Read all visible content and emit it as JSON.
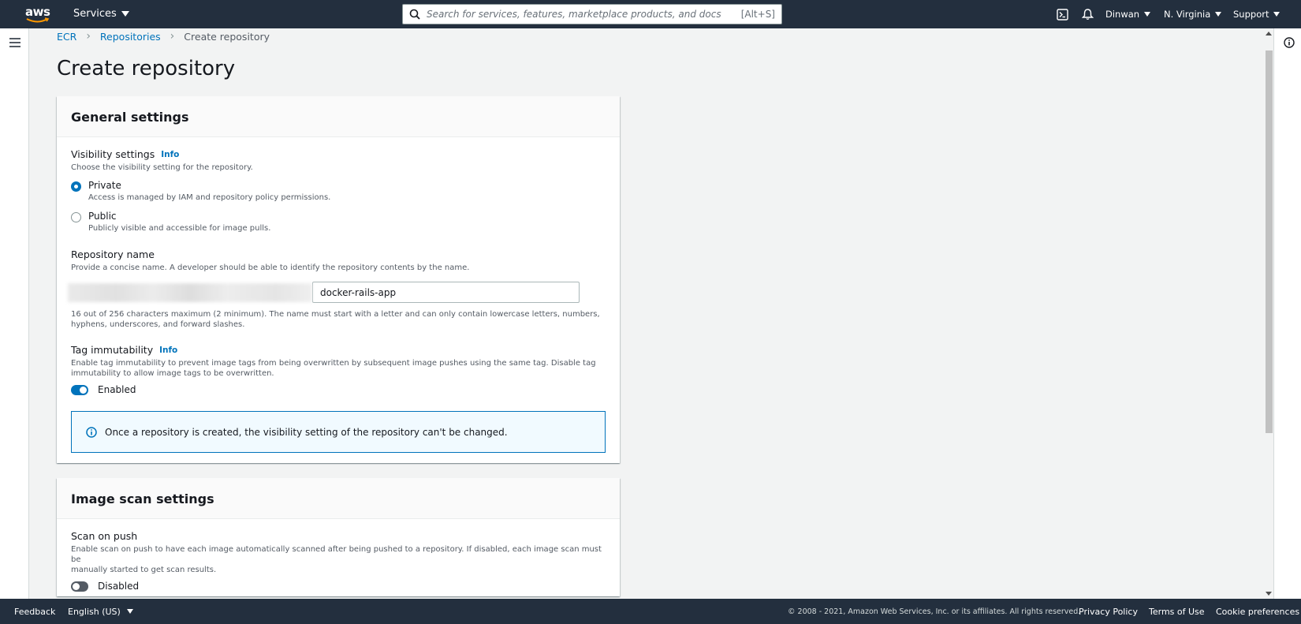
{
  "topnav": {
    "logo": "aws",
    "services_label": "Services",
    "search_placeholder": "Search for services, features, marketplace products, and docs",
    "search_shortcut": "[Alt+S]",
    "account_label": "Dinwan",
    "region_label": "N. Virginia",
    "support_label": "Support"
  },
  "breadcrumb": {
    "items": [
      "ECR",
      "Repositories"
    ],
    "current": "Create repository"
  },
  "page_title": "Create repository",
  "general_settings": {
    "title": "General settings",
    "visibility": {
      "label": "Visibility settings",
      "info": "Info",
      "description": "Choose the visibility setting for the repository.",
      "options": [
        {
          "title": "Private",
          "description": "Access is managed by IAM and repository policy permissions.",
          "checked": true
        },
        {
          "title": "Public",
          "description": "Publicly visible and accessible for image pulls.",
          "checked": false
        }
      ]
    },
    "repository_name": {
      "label": "Repository name",
      "description": "Provide a concise name. A developer should be able to identify the repository contents by the name.",
      "value": "docker-rails-app",
      "hint_line1": "16 out of 256 characters maximum (2 minimum). The name must start with a letter and can only contain lowercase letters, numbers,",
      "hint_line2": "hyphens, underscores, and forward slashes."
    },
    "tag_immutability": {
      "label": "Tag immutability",
      "info": "Info",
      "description_line1": "Enable tag immutability to prevent image tags from being overwritten by subsequent image pushes using the same tag. Disable tag",
      "description_line2": "immutability to allow image tags to be overwritten.",
      "state_label": "Enabled",
      "enabled": true
    },
    "alert_text": "Once a repository is created, the visibility setting of the repository can't be changed."
  },
  "image_scan_settings": {
    "title": "Image scan settings",
    "scan_on_push": {
      "label": "Scan on push",
      "description_line1": "Enable scan on push to have each image automatically scanned after being pushed to a repository. If disabled, each image scan must be",
      "description_line2": "manually started to get scan results.",
      "state_label": "Disabled",
      "enabled": false
    }
  },
  "footer": {
    "feedback": "Feedback",
    "language": "English (US)",
    "copyright": "© 2008 - 2021, Amazon Web Services, Inc. or its affiliates. All rights reserved.",
    "privacy": "Privacy Policy",
    "terms": "Terms of Use",
    "cookies": "Cookie preferences"
  },
  "colors": {
    "nav_bg": "#232f3e",
    "link": "#0073bb",
    "page_bg": "#f2f3f3"
  }
}
